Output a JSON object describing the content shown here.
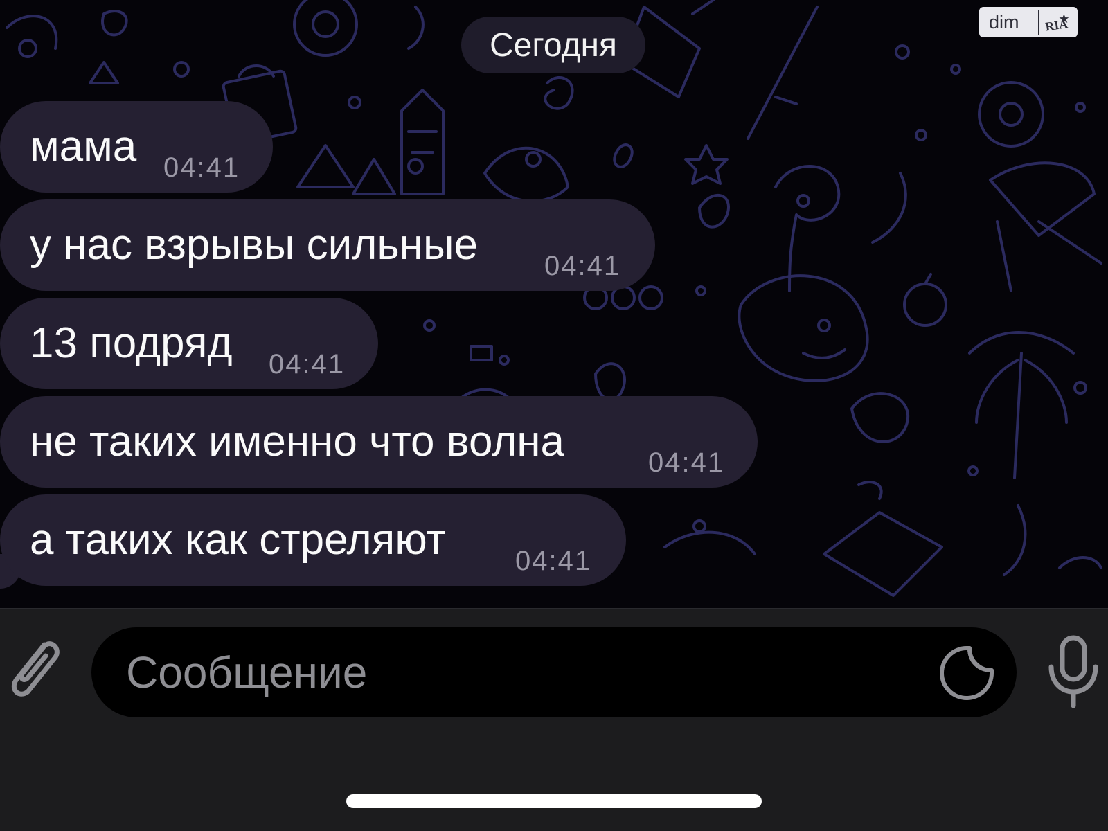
{
  "chat": {
    "date_separator": "Сегодня",
    "messages": [
      {
        "text": "мама",
        "time": "04:41"
      },
      {
        "text": "у нас взрывы сильные",
        "time": "04:41"
      },
      {
        "text": "13 подряд",
        "time": "04:41"
      },
      {
        "text": "не таких именно что волна",
        "time": "04:41"
      },
      {
        "text": "а таких как стреляют",
        "time": "04:41"
      }
    ]
  },
  "watermark": {
    "text": "dim",
    "logo_text": "RIA"
  },
  "composer": {
    "placeholder": "Сообщение",
    "attach_icon": "paperclip-icon",
    "sticker_icon": "sticker-icon",
    "mic_icon": "microphone-icon"
  },
  "colors": {
    "background": "#050409",
    "bubble": "#252032",
    "doodle": "#2b2a5e",
    "input_bar": "#1c1c1e",
    "placeholder": "#8e8e93"
  }
}
